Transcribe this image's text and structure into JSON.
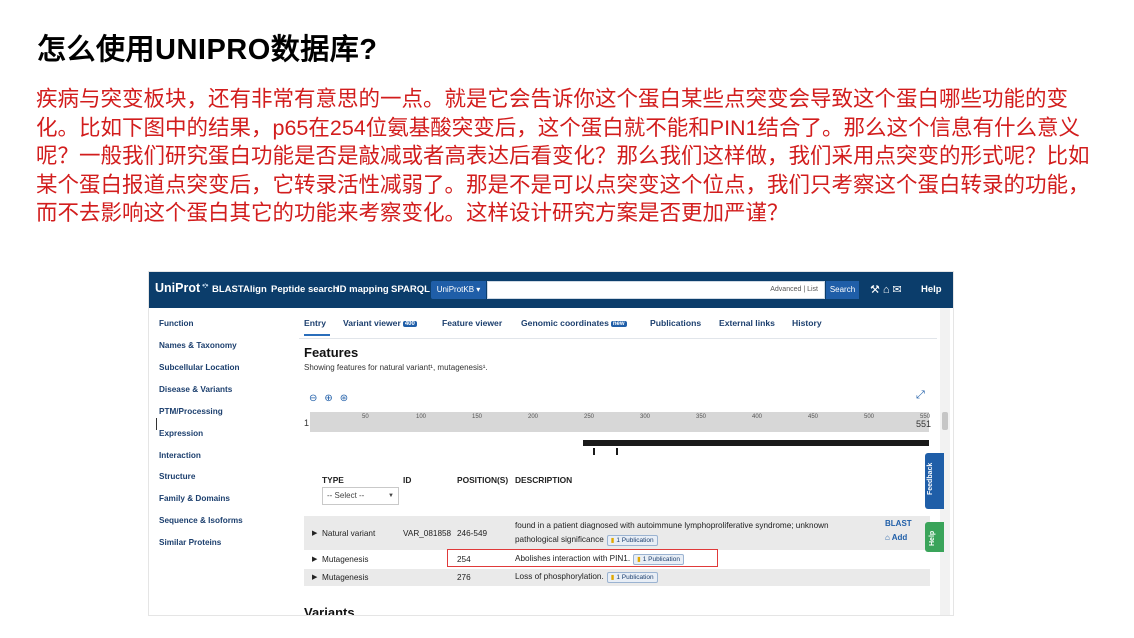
{
  "slide": {
    "title": "怎么使用UNIPRO数据库?",
    "body": "疾病与突变板块，还有非常有意思的一点。就是它会告诉你这个蛋白某些点突变会导致这个蛋白哪些功能的变化。比如下图中的结果，p65在254位氨基酸突变后，这个蛋白就不能和PIN1结合了。那么这个信息有什么意义呢？一般我们研究蛋白功能是否是敲减或者高表达后看变化？那么我们这样做，我们采用点突变的形式呢？比如某个蛋白报道点突变后，它转录活性减弱了。那是不是可以点突变这个位点，我们只考察这个蛋白转录的功能，而不去影响这个蛋白其它的功能来考察变化。这样设计研究方案是否更加严谨？"
  },
  "uniprot": {
    "logo": "UniProt",
    "nav": [
      "BLAST",
      "Align",
      "Peptide search",
      "ID mapping",
      "SPARQL"
    ],
    "kb_dropdown": "UniProtKB ▾",
    "search_value": "",
    "advanced": "Advanced | List",
    "search_button": "Search",
    "help_label": "Help",
    "sidebar": [
      "Function",
      "Names & Taxonomy",
      "Subcellular Location",
      "Disease & Variants",
      "PTM/Processing",
      "Expression",
      "Interaction",
      "Structure",
      "Family & Domains",
      "Sequence & Isoforms",
      "Similar Proteins"
    ],
    "tabs": [
      {
        "label": "Entry",
        "badge": ""
      },
      {
        "label": "Variant viewer",
        "badge": "400"
      },
      {
        "label": "Feature viewer",
        "badge": ""
      },
      {
        "label": "Genomic coordinates",
        "badge": "new"
      },
      {
        "label": "Publications",
        "badge": ""
      },
      {
        "label": "External links",
        "badge": ""
      },
      {
        "label": "History",
        "badge": ""
      }
    ],
    "features_title": "Features",
    "features_sub": "Showing features for natural variant¹, mutagenesis¹.",
    "ruler": {
      "start": "1",
      "end": "551",
      "ticks": [
        "50",
        "100",
        "150",
        "200",
        "250",
        "300",
        "350",
        "400",
        "450",
        "500",
        "550"
      ]
    },
    "table_headers": {
      "type": "TYPE",
      "id": "ID",
      "position": "POSITION(S)",
      "description": "DESCRIPTION"
    },
    "type_select": "-- Select --",
    "rows": [
      {
        "type": "Natural variant",
        "id": "VAR_081858",
        "position": "246-549",
        "description_1": "found in a patient diagnosed with autoimmune lymphoproliferative syndrome; unknown",
        "description_2": "pathological significance",
        "pub": "1 Publication",
        "action_1": "BLAST",
        "action_2": "Add"
      },
      {
        "type": "Mutagenesis",
        "id": "",
        "position": "254",
        "description_1": "Abolishes interaction with PIN1.",
        "pub": "1 Publication"
      },
      {
        "type": "Mutagenesis",
        "id": "",
        "position": "276",
        "description_1": "Loss of phosphorylation.",
        "pub": "1 Publication"
      }
    ],
    "variants_title": "Variants",
    "feedback": "Feedback",
    "help_tab": "Help"
  }
}
